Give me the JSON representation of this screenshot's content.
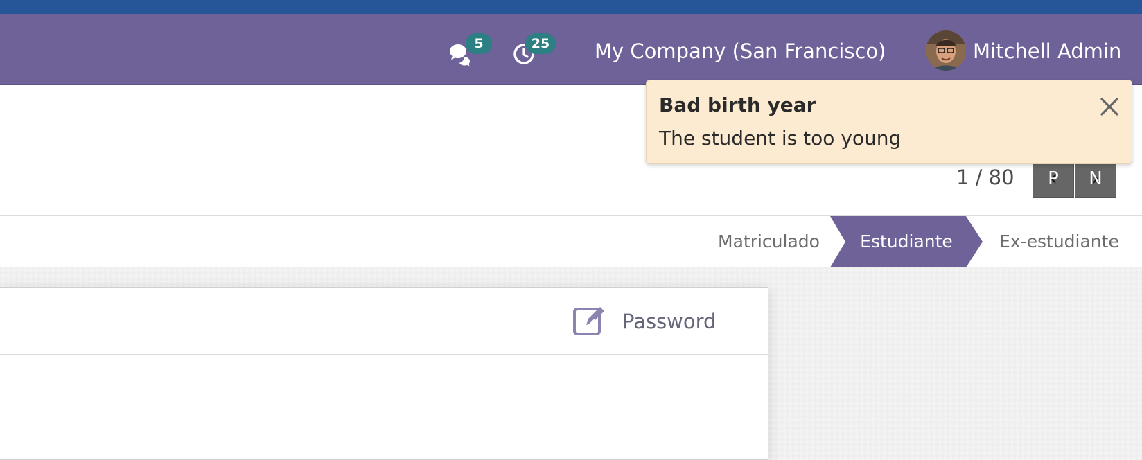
{
  "navbar": {
    "messages_count": "5",
    "activities_count": "25",
    "company": "My Company (San Francisco)",
    "user_name": "Mitchell Admin"
  },
  "notification": {
    "title": "Bad birth year",
    "message": "The student is too young"
  },
  "pager": {
    "value": "1 / 80",
    "prev_label": "P",
    "next_label": "N"
  },
  "statusbar": {
    "stages": [
      "Matriculado",
      "Estudiante",
      "Ex-estudiante"
    ],
    "active_stage": "Estudiante"
  },
  "form": {
    "password_label": "Password"
  },
  "colors": {
    "navbar": "#6e6298",
    "top_strip": "#275698",
    "badge": "#2c7f82",
    "active_stage": "#6e6298",
    "notification_bg": "#fdebd1"
  },
  "icons": {
    "messages": "chat-bubbles-icon",
    "activities": "clock-icon",
    "close": "close-icon",
    "password": "edit-icon",
    "prev": "chevron-left-icon",
    "next": "chevron-right-icon"
  }
}
